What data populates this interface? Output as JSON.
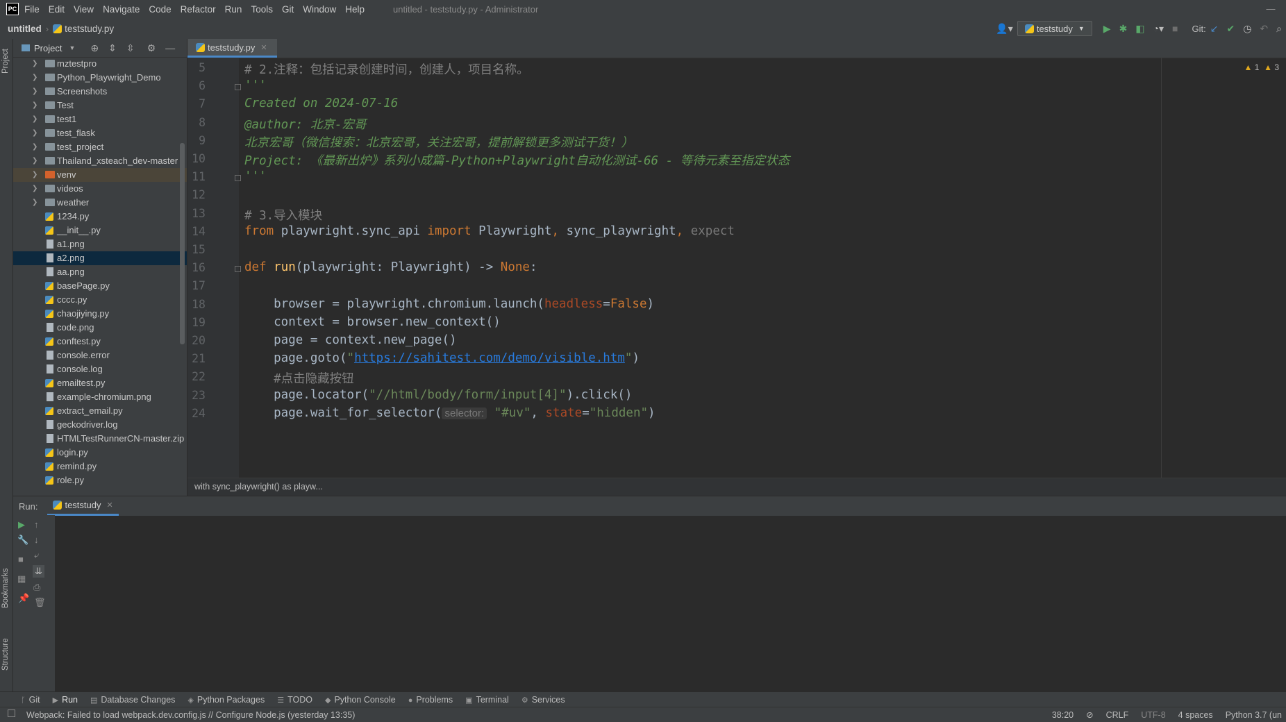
{
  "app": {
    "logo": "PC",
    "menu": [
      "File",
      "Edit",
      "View",
      "Navigate",
      "Code",
      "Refactor",
      "Run",
      "Tools",
      "Git",
      "Window",
      "Help"
    ],
    "window_title": "untitled - teststudy.py - Administrator"
  },
  "navbar": {
    "project": "untitled",
    "file": "teststudy.py",
    "run_config": "teststudy",
    "git_label": "Git:"
  },
  "left_strip": {
    "project_tab": "Project",
    "bookmarks_tab": "Bookmarks",
    "structure_tab": "Structure"
  },
  "project_panel": {
    "title": "Project",
    "tree": [
      {
        "label": "mztestpro",
        "type": "folder"
      },
      {
        "label": "Python_Playwright_Demo",
        "type": "folder"
      },
      {
        "label": "Screenshots",
        "type": "folder"
      },
      {
        "label": "Test",
        "type": "folder"
      },
      {
        "label": "test1",
        "type": "folder"
      },
      {
        "label": "test_flask",
        "type": "folder"
      },
      {
        "label": "test_project",
        "type": "folder"
      },
      {
        "label": "Thailand_xsteach_dev-master",
        "type": "folder"
      },
      {
        "label": "venv",
        "type": "folder-orange"
      },
      {
        "label": "videos",
        "type": "folder"
      },
      {
        "label": "weather",
        "type": "folder"
      },
      {
        "label": "1234.py",
        "type": "py"
      },
      {
        "label": "__init__.py",
        "type": "py"
      },
      {
        "label": "a1.png",
        "type": "file"
      },
      {
        "label": "a2.png",
        "type": "file",
        "selected": true
      },
      {
        "label": "aa.png",
        "type": "file"
      },
      {
        "label": "basePage.py",
        "type": "py"
      },
      {
        "label": "cccc.py",
        "type": "py"
      },
      {
        "label": "chaojiying.py",
        "type": "py"
      },
      {
        "label": "code.png",
        "type": "file"
      },
      {
        "label": "conftest.py",
        "type": "py"
      },
      {
        "label": "console.error",
        "type": "file"
      },
      {
        "label": "console.log",
        "type": "file"
      },
      {
        "label": "emailtest.py",
        "type": "py"
      },
      {
        "label": "example-chromium.png",
        "type": "file"
      },
      {
        "label": "extract_email.py",
        "type": "py"
      },
      {
        "label": "geckodriver.log",
        "type": "file"
      },
      {
        "label": "HTMLTestRunnerCN-master.zip",
        "type": "file"
      },
      {
        "label": "login.py",
        "type": "py"
      },
      {
        "label": "remind.py",
        "type": "py"
      },
      {
        "label": "role.py",
        "type": "py"
      }
    ]
  },
  "editor": {
    "tab": "teststudy.py",
    "warnings": {
      "a": "1",
      "b": "3"
    },
    "lines": [
      {
        "n": "5",
        "segs": [
          {
            "t": "# 2.注释：包括记录创建时间，创建人，项目名称。",
            "c": "cm"
          }
        ]
      },
      {
        "n": "6",
        "segs": [
          {
            "t": "'''",
            "c": "doc"
          }
        ]
      },
      {
        "n": "7",
        "segs": [
          {
            "t": "Created on 2024-07-16",
            "c": "doc"
          }
        ]
      },
      {
        "n": "8",
        "segs": [
          {
            "t": "@author: 北京-宏哥",
            "c": "doc"
          }
        ]
      },
      {
        "n": "9",
        "segs": [
          {
            "t": "北京宏哥（微信搜索：北京宏哥，关注宏哥，提前解锁更多测试干货！）",
            "c": "doc"
          }
        ]
      },
      {
        "n": "10",
        "segs": [
          {
            "t": "Project: 《最新出炉》系列小成篇-Python+Playwright自动化测试-66 - 等待元素至指定状态",
            "c": "doc"
          }
        ]
      },
      {
        "n": "11",
        "segs": [
          {
            "t": "'''",
            "c": "doc"
          }
        ]
      },
      {
        "n": "12",
        "segs": []
      },
      {
        "n": "13",
        "segs": [
          {
            "t": "# 3.导入模块",
            "c": "cm"
          }
        ]
      },
      {
        "n": "14",
        "segs": [
          {
            "t": "from ",
            "c": "kw"
          },
          {
            "t": "playwright.sync_api ",
            "c": ""
          },
          {
            "t": "import ",
            "c": "kw"
          },
          {
            "t": "Playwright",
            "c": ""
          },
          {
            "t": ", ",
            "c": "kw"
          },
          {
            "t": "sync_playwright",
            "c": ""
          },
          {
            "t": ", ",
            "c": "kw"
          },
          {
            "t": "expect",
            "c": "dim"
          }
        ]
      },
      {
        "n": "15",
        "segs": []
      },
      {
        "n": "16",
        "segs": [
          {
            "t": "def ",
            "c": "kw"
          },
          {
            "t": "run",
            "c": "fn"
          },
          {
            "t": "(playwright: Playwright) -> ",
            "c": ""
          },
          {
            "t": "None",
            "c": "kw"
          },
          {
            "t": ":",
            "c": ""
          }
        ]
      },
      {
        "n": "17",
        "segs": []
      },
      {
        "n": "18",
        "segs": [
          {
            "t": "    browser = playwright.chromium.launch(",
            "c": ""
          },
          {
            "t": "headless",
            "c": "par"
          },
          {
            "t": "=",
            "c": ""
          },
          {
            "t": "False",
            "c": "kw"
          },
          {
            "t": ")",
            "c": ""
          }
        ]
      },
      {
        "n": "19",
        "segs": [
          {
            "t": "    context = browser.new_context()",
            "c": ""
          }
        ]
      },
      {
        "n": "20",
        "segs": [
          {
            "t": "    page = context.new_page()",
            "c": ""
          }
        ]
      },
      {
        "n": "21",
        "segs": [
          {
            "t": "    page.goto(",
            "c": ""
          },
          {
            "t": "\"",
            "c": "str"
          },
          {
            "t": "https://sahitest.com/demo/visible.htm",
            "c": "url"
          },
          {
            "t": "\"",
            "c": "str"
          },
          {
            "t": ")",
            "c": ""
          }
        ]
      },
      {
        "n": "22",
        "segs": [
          {
            "t": "    #点击隐藏按钮",
            "c": "cm"
          }
        ]
      },
      {
        "n": "23",
        "segs": [
          {
            "t": "    page.locator(",
            "c": ""
          },
          {
            "t": "\"//html/body/form/input[4]\"",
            "c": "str"
          },
          {
            "t": ").click()",
            "c": ""
          }
        ]
      },
      {
        "n": "24",
        "segs": [
          {
            "t": "    page.wait_for_selector(",
            "c": ""
          },
          {
            "t": "selector:",
            "c": "hint"
          },
          {
            "t": " ",
            "c": ""
          },
          {
            "t": "\"#uv\"",
            "c": "str"
          },
          {
            "t": ", ",
            "c": ""
          },
          {
            "t": "state",
            "c": "par"
          },
          {
            "t": "=",
            "c": ""
          },
          {
            "t": "\"hidden\"",
            "c": "str"
          },
          {
            "t": ")",
            "c": ""
          }
        ]
      }
    ],
    "breadcrumb": "with sync_playwright() as playw..."
  },
  "run_panel": {
    "label": "Run:",
    "tab": "teststudy"
  },
  "tool_windows": [
    {
      "label": "Git",
      "icon": "ᚴ"
    },
    {
      "label": "Run",
      "icon": "▶",
      "active": true
    },
    {
      "label": "Database Changes",
      "icon": "▤"
    },
    {
      "label": "Python Packages",
      "icon": "◈"
    },
    {
      "label": "TODO",
      "icon": "☰"
    },
    {
      "label": "Python Console",
      "icon": "◆"
    },
    {
      "label": "Problems",
      "icon": "●"
    },
    {
      "label": "Terminal",
      "icon": "▣"
    },
    {
      "label": "Services",
      "icon": "⚙"
    }
  ],
  "status": {
    "message": "Webpack: Failed to load webpack.dev.config.js // Configure Node.js (yesterday 13:35)",
    "position": "38:20",
    "line_sep": "CRLF",
    "encoding": "UTF-8",
    "indent": "4 spaces",
    "interpreter": "Python 3.7 (un"
  }
}
